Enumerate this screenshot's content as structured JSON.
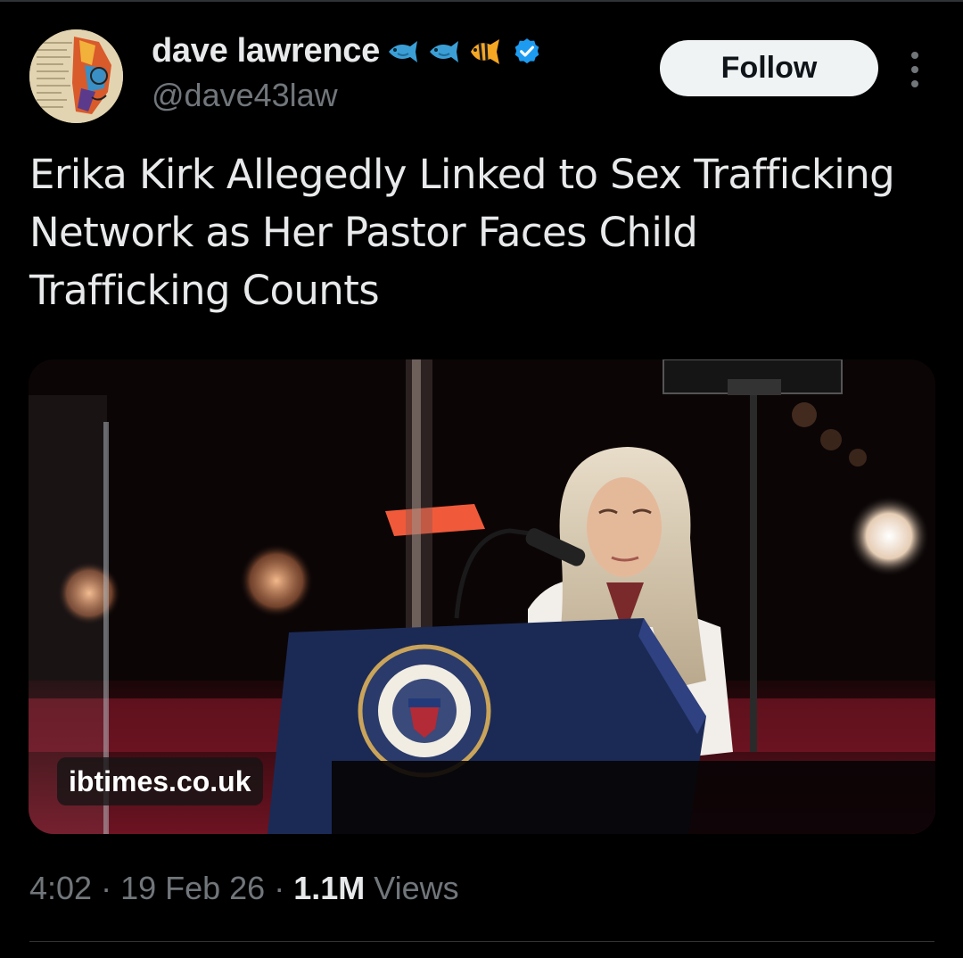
{
  "author": {
    "display_name": "dave lawrence",
    "handle": "@dave43law",
    "name_emojis": [
      "fish-emoji",
      "fish-emoji",
      "tropical-fish-emoji"
    ],
    "verified": true,
    "verified_color": "#1d9bf0"
  },
  "actions": {
    "follow_label": "Follow",
    "more_icon": "more-vertical-icon"
  },
  "tweet": {
    "text_lines": [
      "Erika Kirk Allegedly Linked to Sex Trafficking",
      "Network as Her Pastor Faces Child",
      "Trafficking Counts"
    ]
  },
  "media": {
    "source_label": "ibtimes.co.uk"
  },
  "meta": {
    "time": "4:02",
    "sep1": " · ",
    "date": "19 Feb 26",
    "sep2": " · ",
    "views_count": "1.1M",
    "views_label": " Views"
  },
  "colors": {
    "background": "#000000",
    "text_primary": "#e7e9ea",
    "text_secondary": "#71767b",
    "follow_bg": "#eff3f4"
  }
}
